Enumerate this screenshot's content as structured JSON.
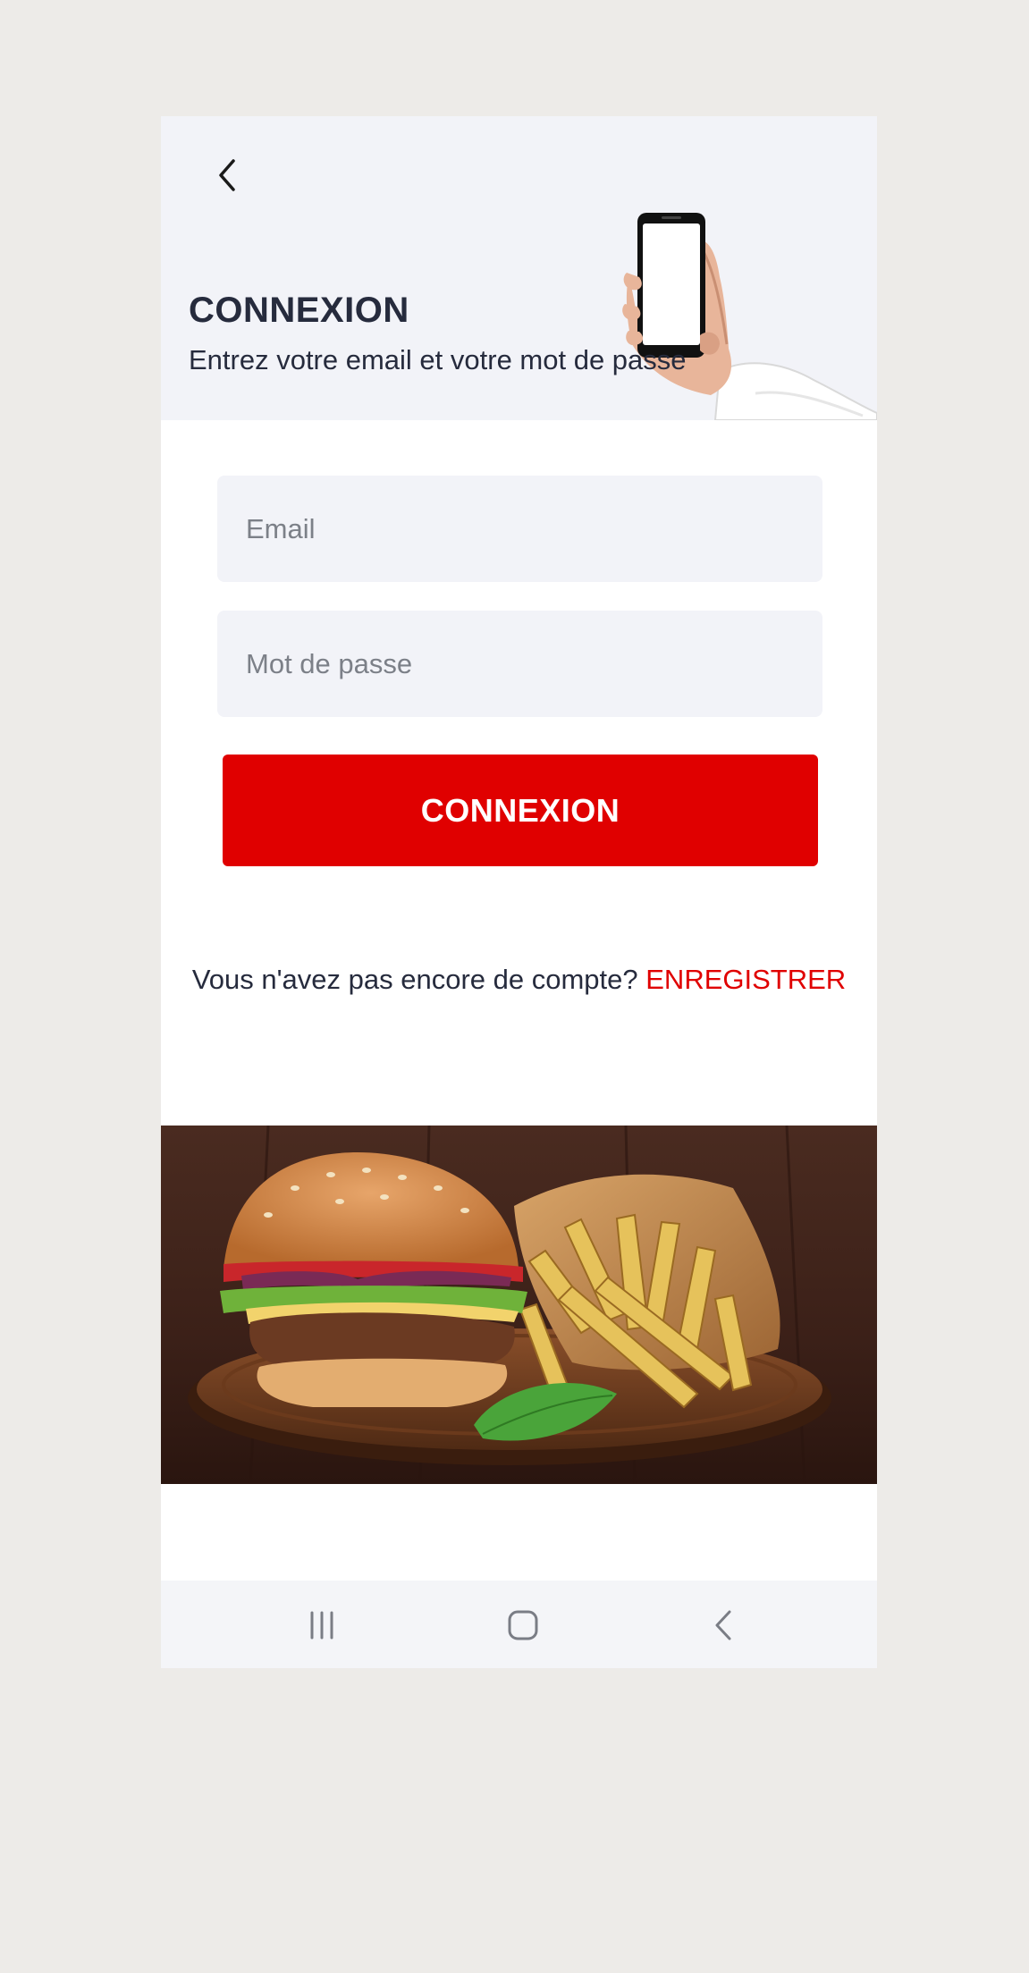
{
  "header": {
    "title": "CONNEXION",
    "subtitle": "Entrez votre email et votre mot de passe",
    "back_icon": "chevron-left-icon"
  },
  "form": {
    "email_placeholder": "Email",
    "email_value": "",
    "password_placeholder": "Mot de passe",
    "password_value": "",
    "login_label": "CONNEXION"
  },
  "register": {
    "prompt": "Vous n'avez pas encore de compte? ",
    "link_label": "ENREGISTRER"
  },
  "navbar": {
    "recent_icon": "recent-apps-icon",
    "home_icon": "home-icon",
    "back_icon": "back-icon"
  },
  "colors": {
    "accent": "#e00000",
    "header_bg": "#f2f3f8",
    "text": "#262b3d"
  }
}
